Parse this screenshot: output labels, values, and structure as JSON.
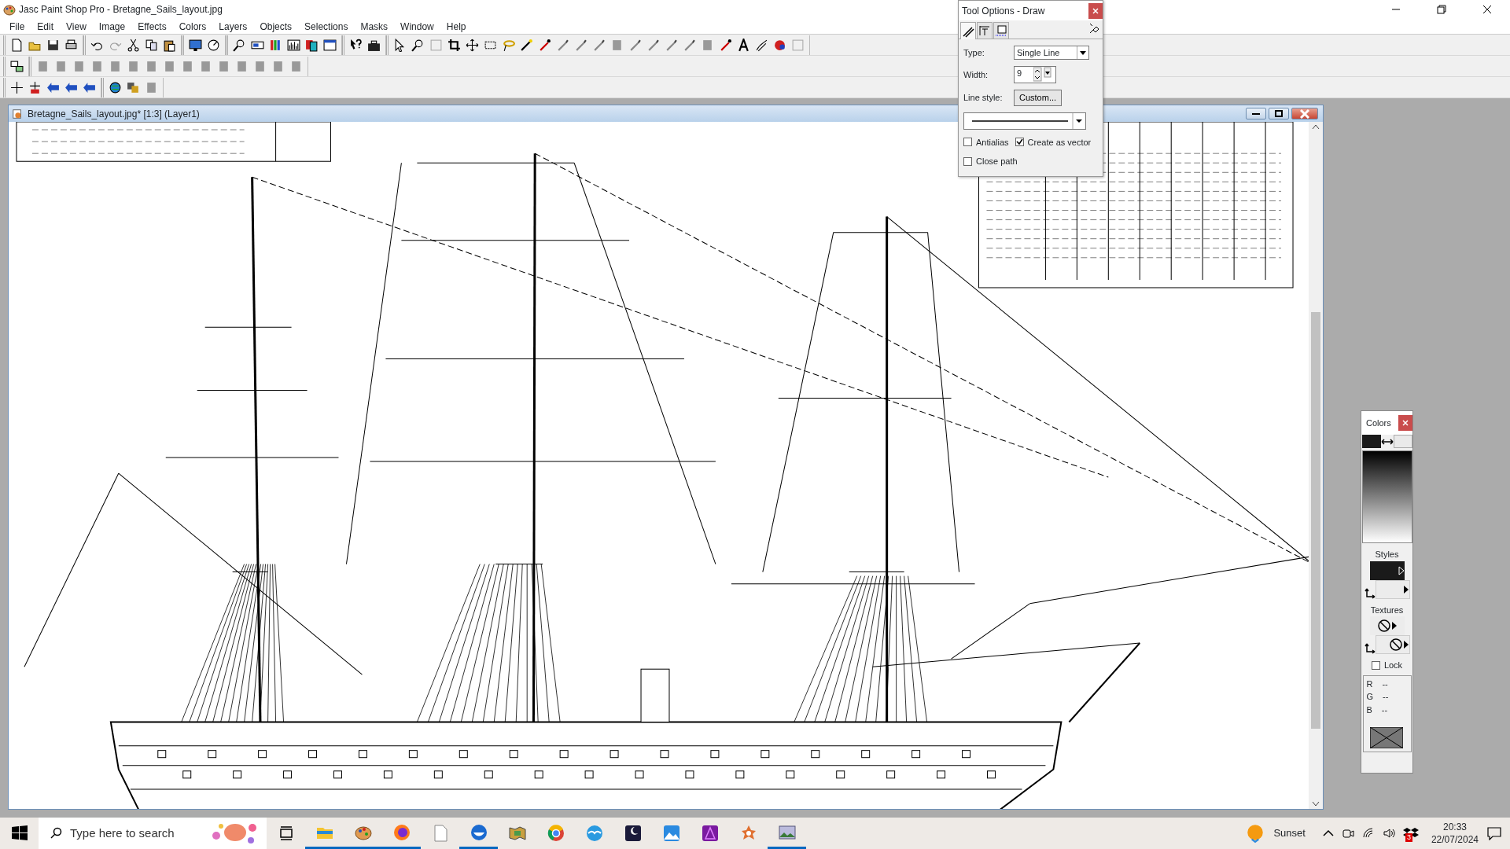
{
  "window": {
    "title": "Jasc Paint Shop Pro - Bretagne_Sails_layout.jpg"
  },
  "menu": [
    "File",
    "Edit",
    "View",
    "Image",
    "Effects",
    "Colors",
    "Layers",
    "Objects",
    "Selections",
    "Masks",
    "Window",
    "Help"
  ],
  "document": {
    "title": "Bretagne_Sails_layout.jpg* [1:3] (Layer1)"
  },
  "tool_options": {
    "title": "Tool Options - Draw",
    "tabs": [
      {
        "selected": true
      },
      {
        "selected": false
      },
      {
        "selected": false
      }
    ],
    "type": {
      "label": "Type:",
      "value": "Single Line"
    },
    "width": {
      "label": "Width:",
      "value": "9"
    },
    "line_style": {
      "label": "Line style:",
      "button": "Custom..."
    },
    "checkboxes": [
      {
        "label": "Antialias",
        "checked": false
      },
      {
        "label": "Create as vector",
        "checked": true
      },
      {
        "label": "Close path",
        "checked": false
      }
    ]
  },
  "colors": {
    "title": "Colors",
    "styles_label": "Styles",
    "textures_label": "Textures",
    "lock": {
      "label": "Lock",
      "checked": false
    },
    "rgb": [
      {
        "label": "R",
        "value": "--"
      },
      {
        "label": "G",
        "value": "--"
      },
      {
        "label": "B",
        "value": "--"
      }
    ]
  },
  "taskbar": {
    "search_placeholder": "Type here to search",
    "apps": [
      {
        "kind": "folder",
        "running": true
      },
      {
        "kind": "palette",
        "running": true
      },
      {
        "kind": "globe",
        "running": true
      },
      {
        "kind": "page",
        "running": false
      },
      {
        "kind": "bird",
        "running": true
      },
      {
        "kind": "map",
        "running": false
      },
      {
        "kind": "wheel",
        "running": false
      },
      {
        "kind": "gull",
        "running": false
      },
      {
        "kind": "moon",
        "running": false
      },
      {
        "kind": "mountain",
        "running": false
      },
      {
        "kind": "triangle",
        "running": false
      },
      {
        "kind": "flower",
        "running": false
      },
      {
        "kind": "picture",
        "running": true
      }
    ],
    "weather": "Sunset",
    "badge": "3",
    "time": "20:33",
    "date": "22/07/2024"
  }
}
